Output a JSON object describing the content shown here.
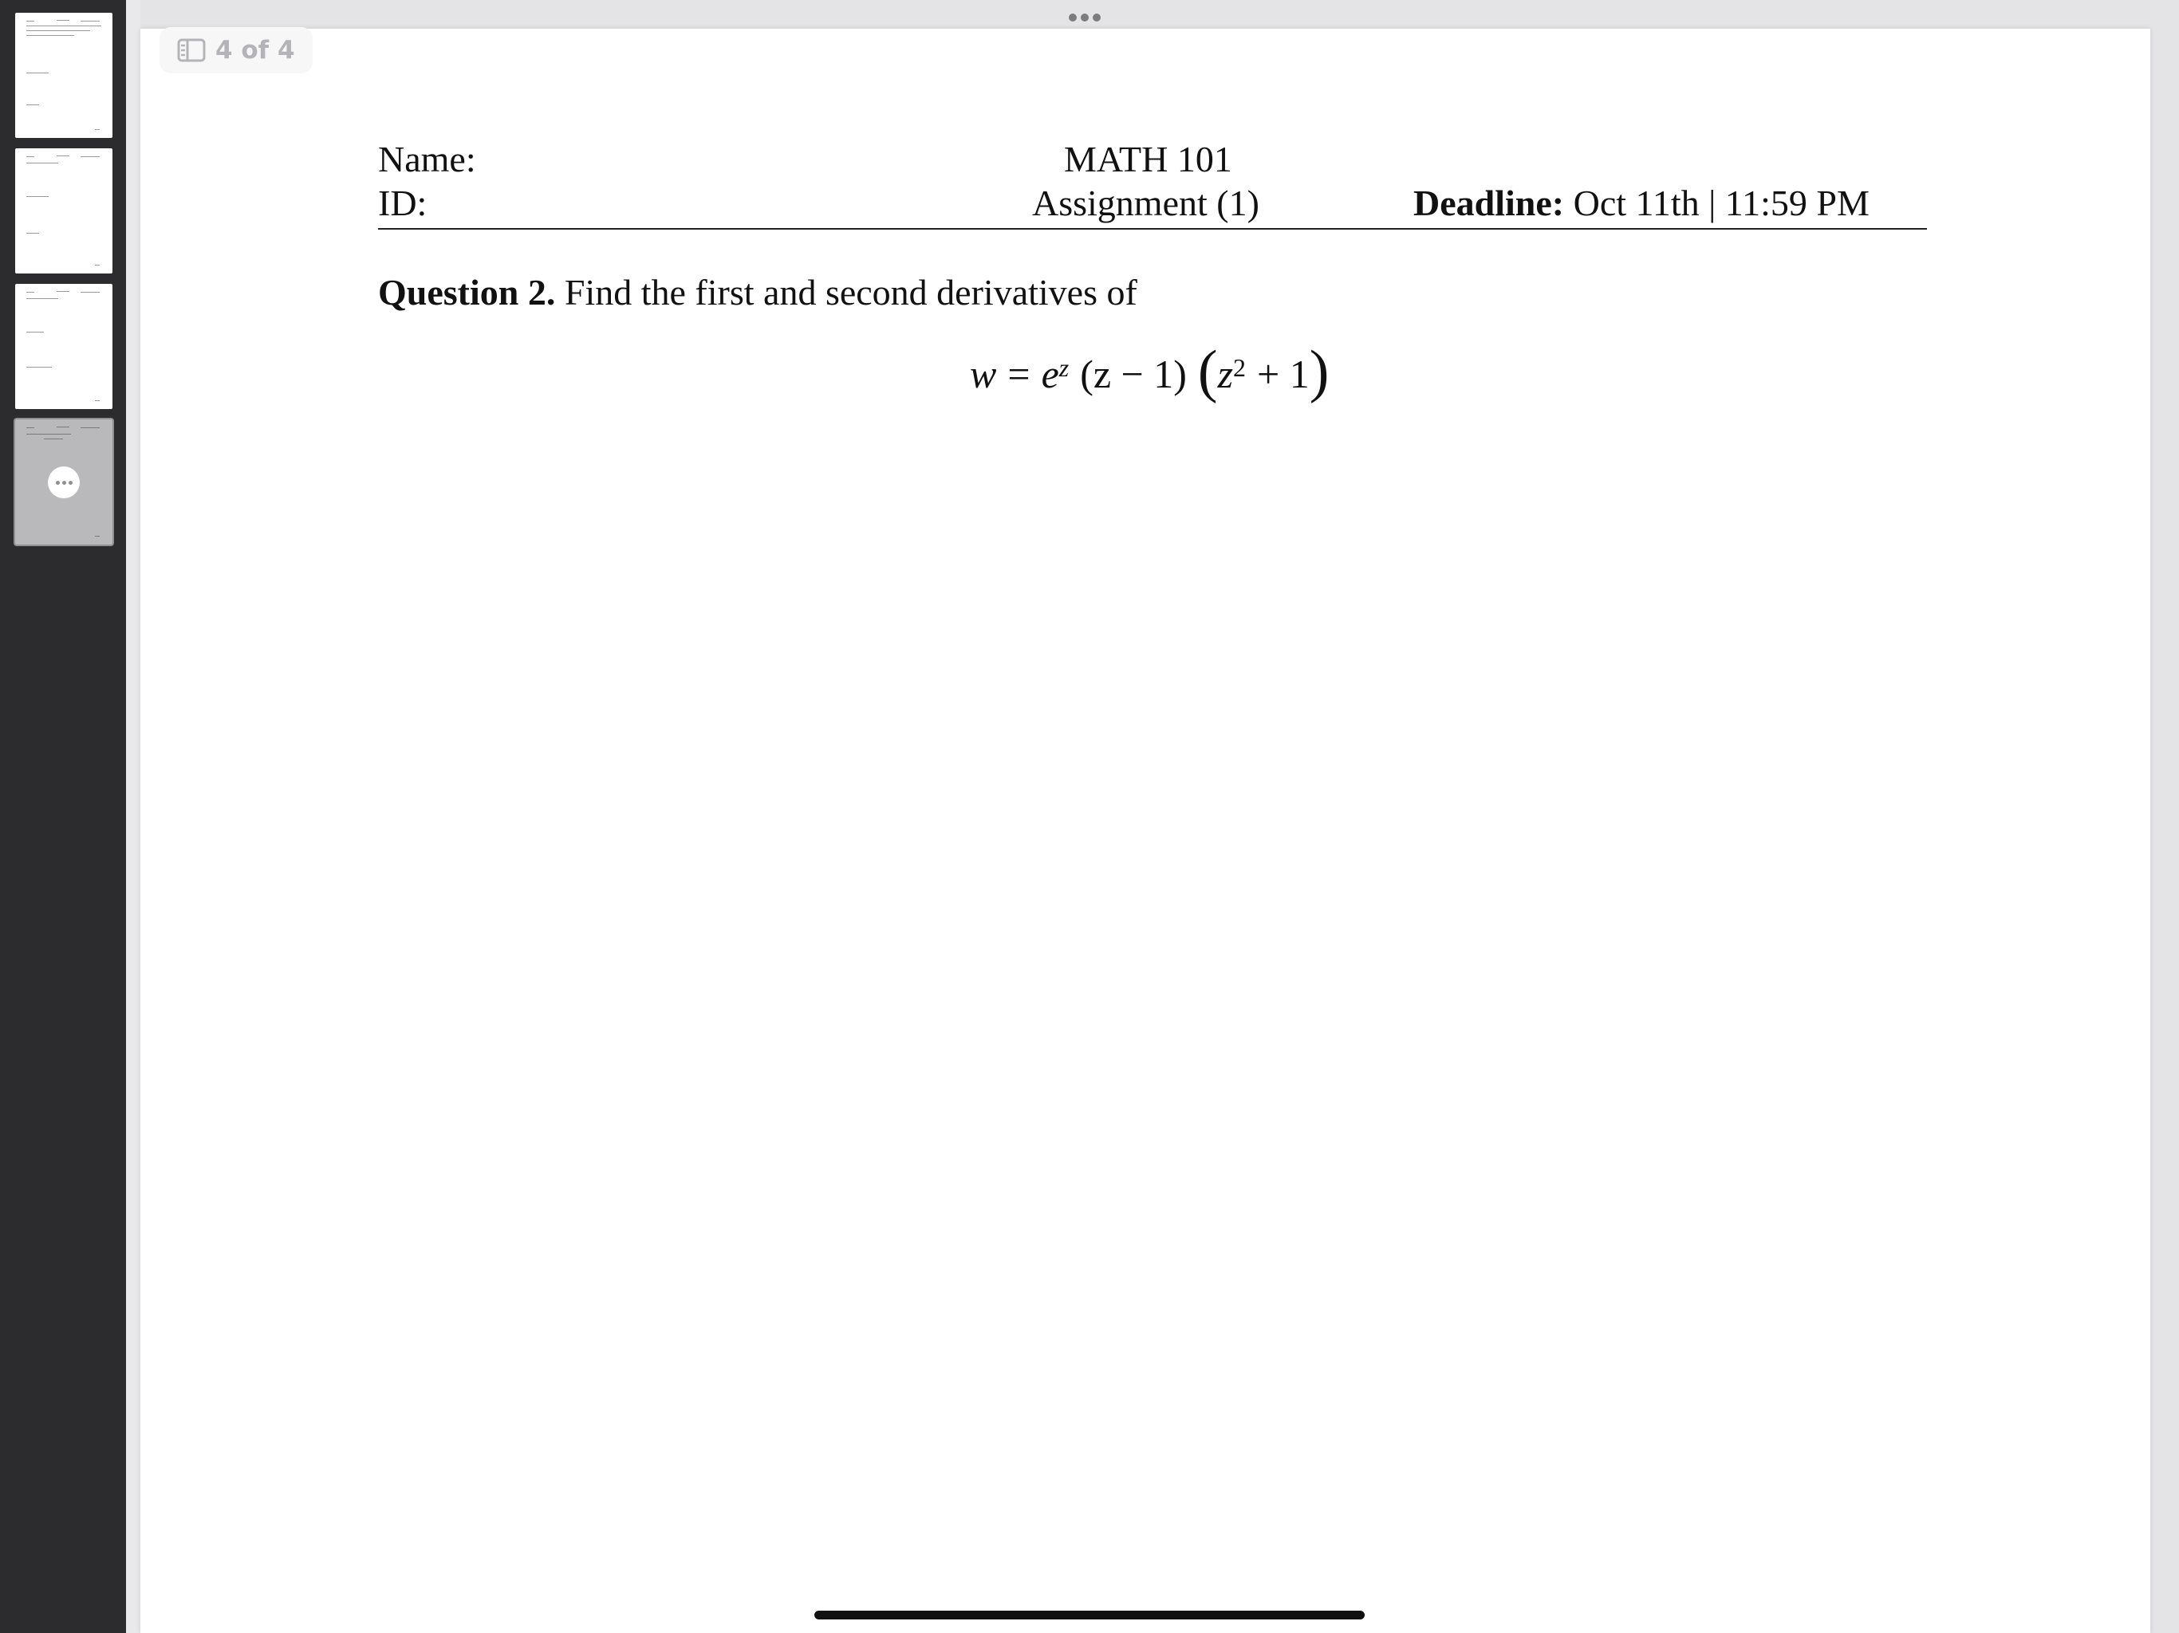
{
  "app": {
    "page_indicator": "4 of 4",
    "sidebar_icon": "sidebar-icon",
    "thumbnail_more_icon": "ellipsis-icon",
    "top_grabber_icon": "ellipsis-icon"
  },
  "thumbnails": [
    {
      "label": "Page 1",
      "selected": false
    },
    {
      "label": "Page 2",
      "selected": false
    },
    {
      "label": "Page 3",
      "selected": false
    },
    {
      "label": "Page 4",
      "selected": true
    }
  ],
  "document": {
    "header": {
      "name_label": "Name:",
      "id_label": "ID:",
      "course": "MATH 101",
      "assignment": "Assignment (1)",
      "deadline_label": "Deadline:",
      "deadline_value": "Oct 11th | 11:59 PM"
    },
    "question": {
      "label": "Question 2.",
      "text": "Find the first and second derivatives of"
    },
    "equation": {
      "lhs": "w",
      "equals": "=",
      "base": "e",
      "exponent": "z",
      "factor1": "(z − 1)",
      "factor2_var": "z",
      "factor2_exp": "2",
      "factor2_rest": "+ 1"
    }
  }
}
